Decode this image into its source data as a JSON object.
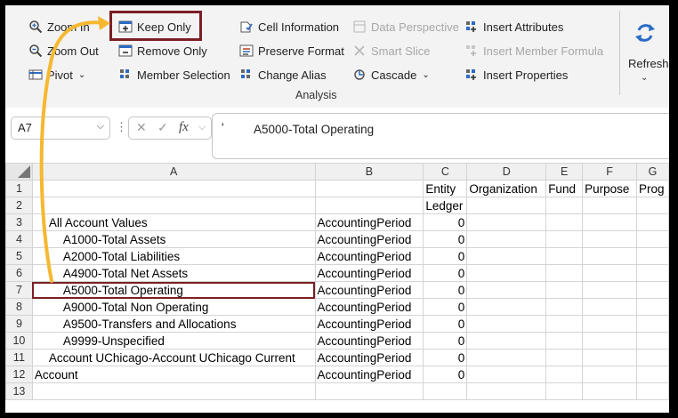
{
  "ribbon": {
    "col1": [
      {
        "label": "Zoom In",
        "icon": "zoom-in-icon",
        "disabled": false
      },
      {
        "label": "Zoom Out",
        "icon": "zoom-out-icon",
        "disabled": false
      },
      {
        "label": "Pivot",
        "icon": "pivot-icon",
        "disabled": false,
        "has_dropdown": true
      }
    ],
    "col2": [
      {
        "label": "Keep Only",
        "icon": "keep-only-icon",
        "disabled": false
      },
      {
        "label": "Remove Only",
        "icon": "remove-only-icon",
        "disabled": false
      },
      {
        "label": "Member Selection",
        "icon": "member-selection-icon",
        "disabled": false
      }
    ],
    "col3": [
      {
        "label": "Cell Information",
        "icon": "cell-information-icon",
        "disabled": false
      },
      {
        "label": "Preserve Format",
        "icon": "preserve-format-icon",
        "disabled": false
      },
      {
        "label": "Change Alias",
        "icon": "change-alias-icon",
        "disabled": false
      }
    ],
    "col4": [
      {
        "label": "Data Perspective",
        "icon": "data-perspective-icon",
        "disabled": true
      },
      {
        "label": "Smart Slice",
        "icon": "smart-slice-icon",
        "disabled": true
      },
      {
        "label": "Cascade",
        "icon": "cascade-icon",
        "disabled": false,
        "has_dropdown": true
      }
    ],
    "col5": [
      {
        "label": "Insert Attributes",
        "icon": "insert-attributes-icon",
        "disabled": false
      },
      {
        "label": "Insert Member Formula",
        "icon": "insert-member-formula-icon",
        "disabled": true
      },
      {
        "label": "Insert Properties",
        "icon": "insert-properties-icon",
        "disabled": false
      }
    ],
    "group_label": "Analysis",
    "refresh_label": "Refresh",
    "colors": {
      "highlight": "#7b1f24",
      "arrow": "#f5b830",
      "icon_blue": "#2b6cc4"
    }
  },
  "formula_bar": {
    "name_box": "A7",
    "fx_label": "fx",
    "quote": "'",
    "value": "A5000-Total Operating"
  },
  "sheet": {
    "columns": [
      "A",
      "B",
      "C",
      "D",
      "E",
      "F",
      "G"
    ],
    "rows": [
      {
        "n": "1",
        "a": "",
        "b": "",
        "c": "Entity",
        "d": "Organization",
        "e": "Fund",
        "f": "Purpose",
        "g": "Prog"
      },
      {
        "n": "2",
        "a": "",
        "b": "",
        "c": "Ledger",
        "d": "",
        "e": "",
        "f": "",
        "g": ""
      },
      {
        "n": "3",
        "a": "All Account Values",
        "indent": 1,
        "b": "AccountingPeriod",
        "c": "0"
      },
      {
        "n": "4",
        "a": "A1000-Total Assets",
        "indent": 2,
        "b": "AccountingPeriod",
        "c": "0"
      },
      {
        "n": "5",
        "a": "A2000-Total Liabilities",
        "indent": 2,
        "b": "AccountingPeriod",
        "c": "0"
      },
      {
        "n": "6",
        "a": "A4900-Total Net Assets",
        "indent": 2,
        "b": "AccountingPeriod",
        "c": "0"
      },
      {
        "n": "7",
        "a": "A5000-Total Operating",
        "indent": 2,
        "b": "AccountingPeriod",
        "c": "0",
        "selected": true
      },
      {
        "n": "8",
        "a": "A9000-Total Non Operating",
        "indent": 2,
        "b": "AccountingPeriod",
        "c": "0"
      },
      {
        "n": "9",
        "a": "A9500-Transfers and Allocations",
        "indent": 2,
        "b": "AccountingPeriod",
        "c": "0"
      },
      {
        "n": "10",
        "a": "A9999-Unspecified",
        "indent": 2,
        "b": "AccountingPeriod",
        "c": "0"
      },
      {
        "n": "11",
        "a": "Account UChicago-Account UChicago Current",
        "indent": 1,
        "b": "AccountingPeriod",
        "c": "0"
      },
      {
        "n": "12",
        "a": "Account",
        "indent": 0,
        "b": "AccountingPeriod",
        "c": "0"
      },
      {
        "n": "13",
        "a": "",
        "b": "",
        "c": ""
      }
    ]
  }
}
